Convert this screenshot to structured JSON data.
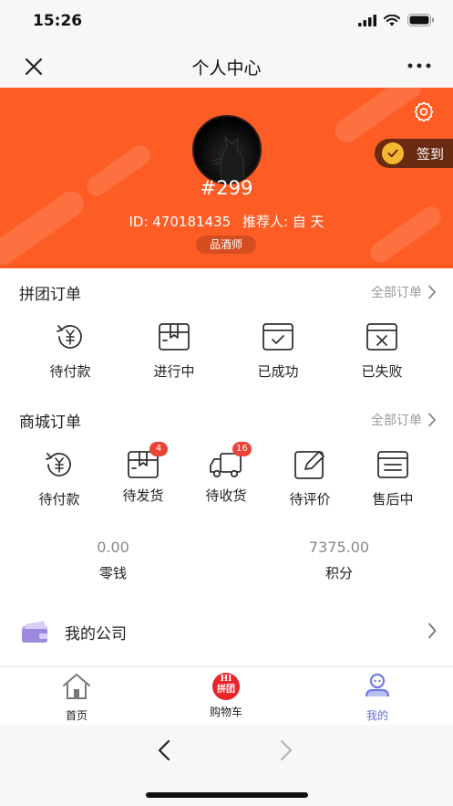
{
  "status_bar": {
    "time": "15:26"
  },
  "nav": {
    "title": "个人中心"
  },
  "profile": {
    "username": "#299",
    "id_text": "ID: 470181435",
    "referrer_text": "推荐人: 自 天",
    "role": "品酒师",
    "signin_label": "签到"
  },
  "group_orders": {
    "title": "拼团订单",
    "all_label": "全部订单",
    "items": [
      {
        "label": "待付款",
        "icon": "yuan-refresh-icon"
      },
      {
        "label": "进行中",
        "icon": "box-icon"
      },
      {
        "label": "已成功",
        "icon": "check-box-icon"
      },
      {
        "label": "已失败",
        "icon": "x-box-icon"
      }
    ]
  },
  "mall_orders": {
    "title": "商城订单",
    "all_label": "全部订单",
    "items": [
      {
        "label": "待付款",
        "icon": "yuan-refresh-icon",
        "badge": ""
      },
      {
        "label": "待发货",
        "icon": "box-icon",
        "badge": "4"
      },
      {
        "label": "待收货",
        "icon": "truck-icon",
        "badge": "16"
      },
      {
        "label": "待评价",
        "icon": "edit-icon",
        "badge": ""
      },
      {
        "label": "售后中",
        "icon": "list-box-icon",
        "badge": ""
      }
    ]
  },
  "balances": {
    "change_value": "0.00",
    "change_label": "零钱",
    "points_value": "7375.00",
    "points_label": "积分"
  },
  "company": {
    "label": "我的公司"
  },
  "tabs": [
    {
      "label": "首页",
      "icon": "home-icon"
    },
    {
      "label": "购物车",
      "icon": "hi-group-icon",
      "icon_text_top": "HI",
      "icon_text_bottom": "拼团"
    },
    {
      "label": "我的",
      "icon": "profile-icon"
    }
  ],
  "colors": {
    "header_bg": "#fd5d25",
    "signin_bg": "#6b2a12",
    "badge_bg": "#e94436",
    "active_tab": "#5b6bd6"
  }
}
